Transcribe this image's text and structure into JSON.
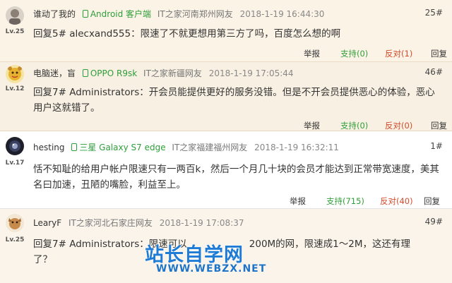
{
  "comments": [
    {
      "user": "谁动了我的",
      "device": "Android 客户端",
      "source": "IT之家河南郑州网友",
      "time": "2018-1-19 16:44:30",
      "floor": "25#",
      "level": "Lv.25",
      "content": "回复5# alecxand555：限速了不就更想用第三方了吗，百度怎么想的啊",
      "actions": {
        "report": "举报",
        "support": "支持(0)",
        "oppose": "反对(1)",
        "reply": "回复"
      }
    },
    {
      "user": "电脑迷，盲",
      "device": "OPPO R9sk",
      "source": "IT之家新疆网友",
      "time": "2018-1-19 17:05:44",
      "floor": "46#",
      "level": "Lv.12",
      "content": "回复7# Administrators：开会员能提供更好的服务没错。但是不开会员提供恶心的体验，恶心用户这就错了。",
      "actions": {
        "report": "举报",
        "support": "支持(0)",
        "oppose": "反对(0)",
        "reply": "回复"
      }
    },
    {
      "user": "hesting",
      "device": "三星 Galaxy S7 edge",
      "source": "IT之家福建福州网友",
      "time": "2018-1-19 16:32:11",
      "floor": "1#",
      "level": "Lv.17",
      "content": "恬不知耻的给用户帐户限速只有一两百k，然后一个月几十块的会员才能达到正常带宽速度，美其名曰加速，丑陋的嘴脸，利益至上。",
      "actions": {
        "report": "举报",
        "support": "支持(715)",
        "oppose": "反对(40)",
        "reply": "回复"
      }
    },
    {
      "user": "LearyF",
      "device": "",
      "source": "IT之家河北石家庄网友",
      "time": "2018-1-19 17:08:37",
      "floor": "49#",
      "level": "Lv.25",
      "content_a": "回复7# Administrators：限速可以",
      "content_b": "200M的网，限速成1～2M，这还有理",
      "content_c": "了？"
    }
  ],
  "watermark": {
    "title": "站长自学网",
    "url": "WWW.WEBZX.NET"
  }
}
